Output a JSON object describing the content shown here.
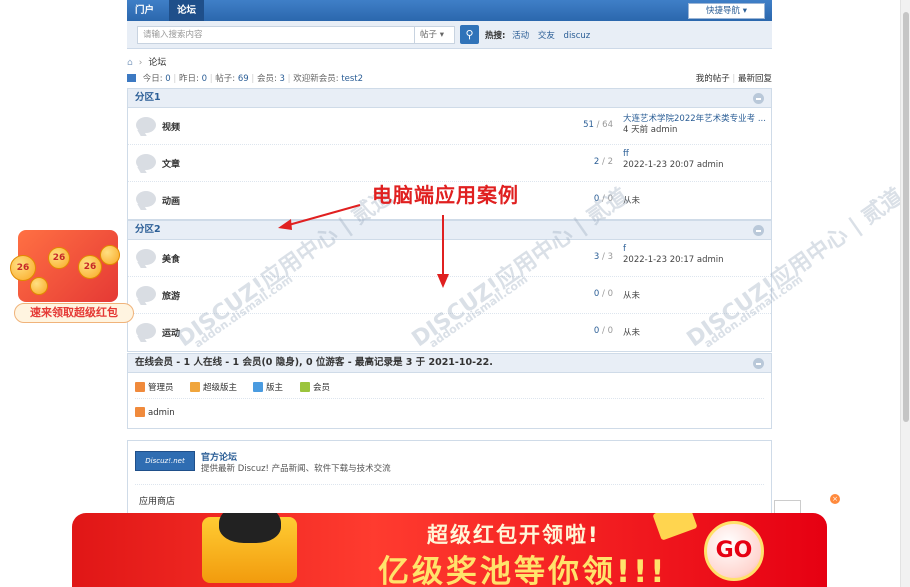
{
  "nav": {
    "tabs": [
      {
        "label": "门户"
      },
      {
        "label": "论坛"
      }
    ],
    "quick_nav": "快捷导航 ▾"
  },
  "search": {
    "placeholder": "请输入搜索内容",
    "type": "帖子",
    "hot_label": "热搜:",
    "hot_words": [
      "活动",
      "交友",
      "discuz"
    ]
  },
  "breadcrumb": {
    "current": "论坛"
  },
  "stats": {
    "today_label": "今日:",
    "today": "0",
    "yesterday_label": "昨日:",
    "yesterday": "0",
    "posts_label": "帖子:",
    "posts": "69",
    "members_label": "会员:",
    "members": "3",
    "welcome_label": "欢迎新会员:",
    "newest": "test2"
  },
  "right_links": {
    "my_posts": "我的帖子",
    "latest": "最新回复"
  },
  "categories": [
    {
      "title": "分区1",
      "forums": [
        {
          "name": "视频",
          "threads": "51",
          "posts": "64",
          "last_title": "大连艺术学院2022年艺术类专业考 ...",
          "last_meta": "4 天前 admin"
        },
        {
          "name": "文章",
          "threads": "2",
          "posts": "2",
          "last_title": "ff",
          "last_meta": "2022-1-23 20:07 admin"
        },
        {
          "name": "动画",
          "threads": "0",
          "posts": "0",
          "last_title": "",
          "last_meta": "从未"
        }
      ]
    },
    {
      "title": "分区2",
      "forums": [
        {
          "name": "美食",
          "threads": "3",
          "posts": "3",
          "last_title": "f",
          "last_meta": "2022-1-23 20:17 admin"
        },
        {
          "name": "旅游",
          "threads": "0",
          "posts": "0",
          "last_title": "",
          "last_meta": "从未"
        },
        {
          "name": "运动",
          "threads": "0",
          "posts": "0",
          "last_title": "",
          "last_meta": "从未"
        }
      ]
    }
  ],
  "online": {
    "header": "在线会员 - 1 人在线 - 1 会员(0 隐身), 0 位游客 - 最高记录是 3 于 2021-10-22.",
    "legend": [
      {
        "label": "管理员",
        "color": "#f08a3c"
      },
      {
        "label": "超级版主",
        "color": "#f0a53c"
      },
      {
        "label": "版主",
        "color": "#4a9be0"
      },
      {
        "label": "会员",
        "color": "#9bc43c"
      }
    ],
    "users": [
      "admin"
    ]
  },
  "links": {
    "logo_text": "Discuz!.net",
    "name": "官方论坛",
    "desc": "提供最新 Discuz! 产品新闻、软件下载与技术交流",
    "shop": "应用商店"
  },
  "annotation": "电脑端应用案例",
  "watermark": {
    "brand": "DISCUZ!应用中心 | 贰道",
    "domain": "addon.dismall.com"
  },
  "promo_side": {
    "label": "速来领取超级红包",
    "coin_text": "26"
  },
  "promo_banner": {
    "line1": "超级红包开领啦!",
    "line2": "亿级奖池等你领!!!",
    "go": "GO"
  },
  "colors": {
    "nav": "#2b67ad",
    "accent": "#2b5e96",
    "annotation": "#e02020",
    "banner": "#e60012"
  }
}
